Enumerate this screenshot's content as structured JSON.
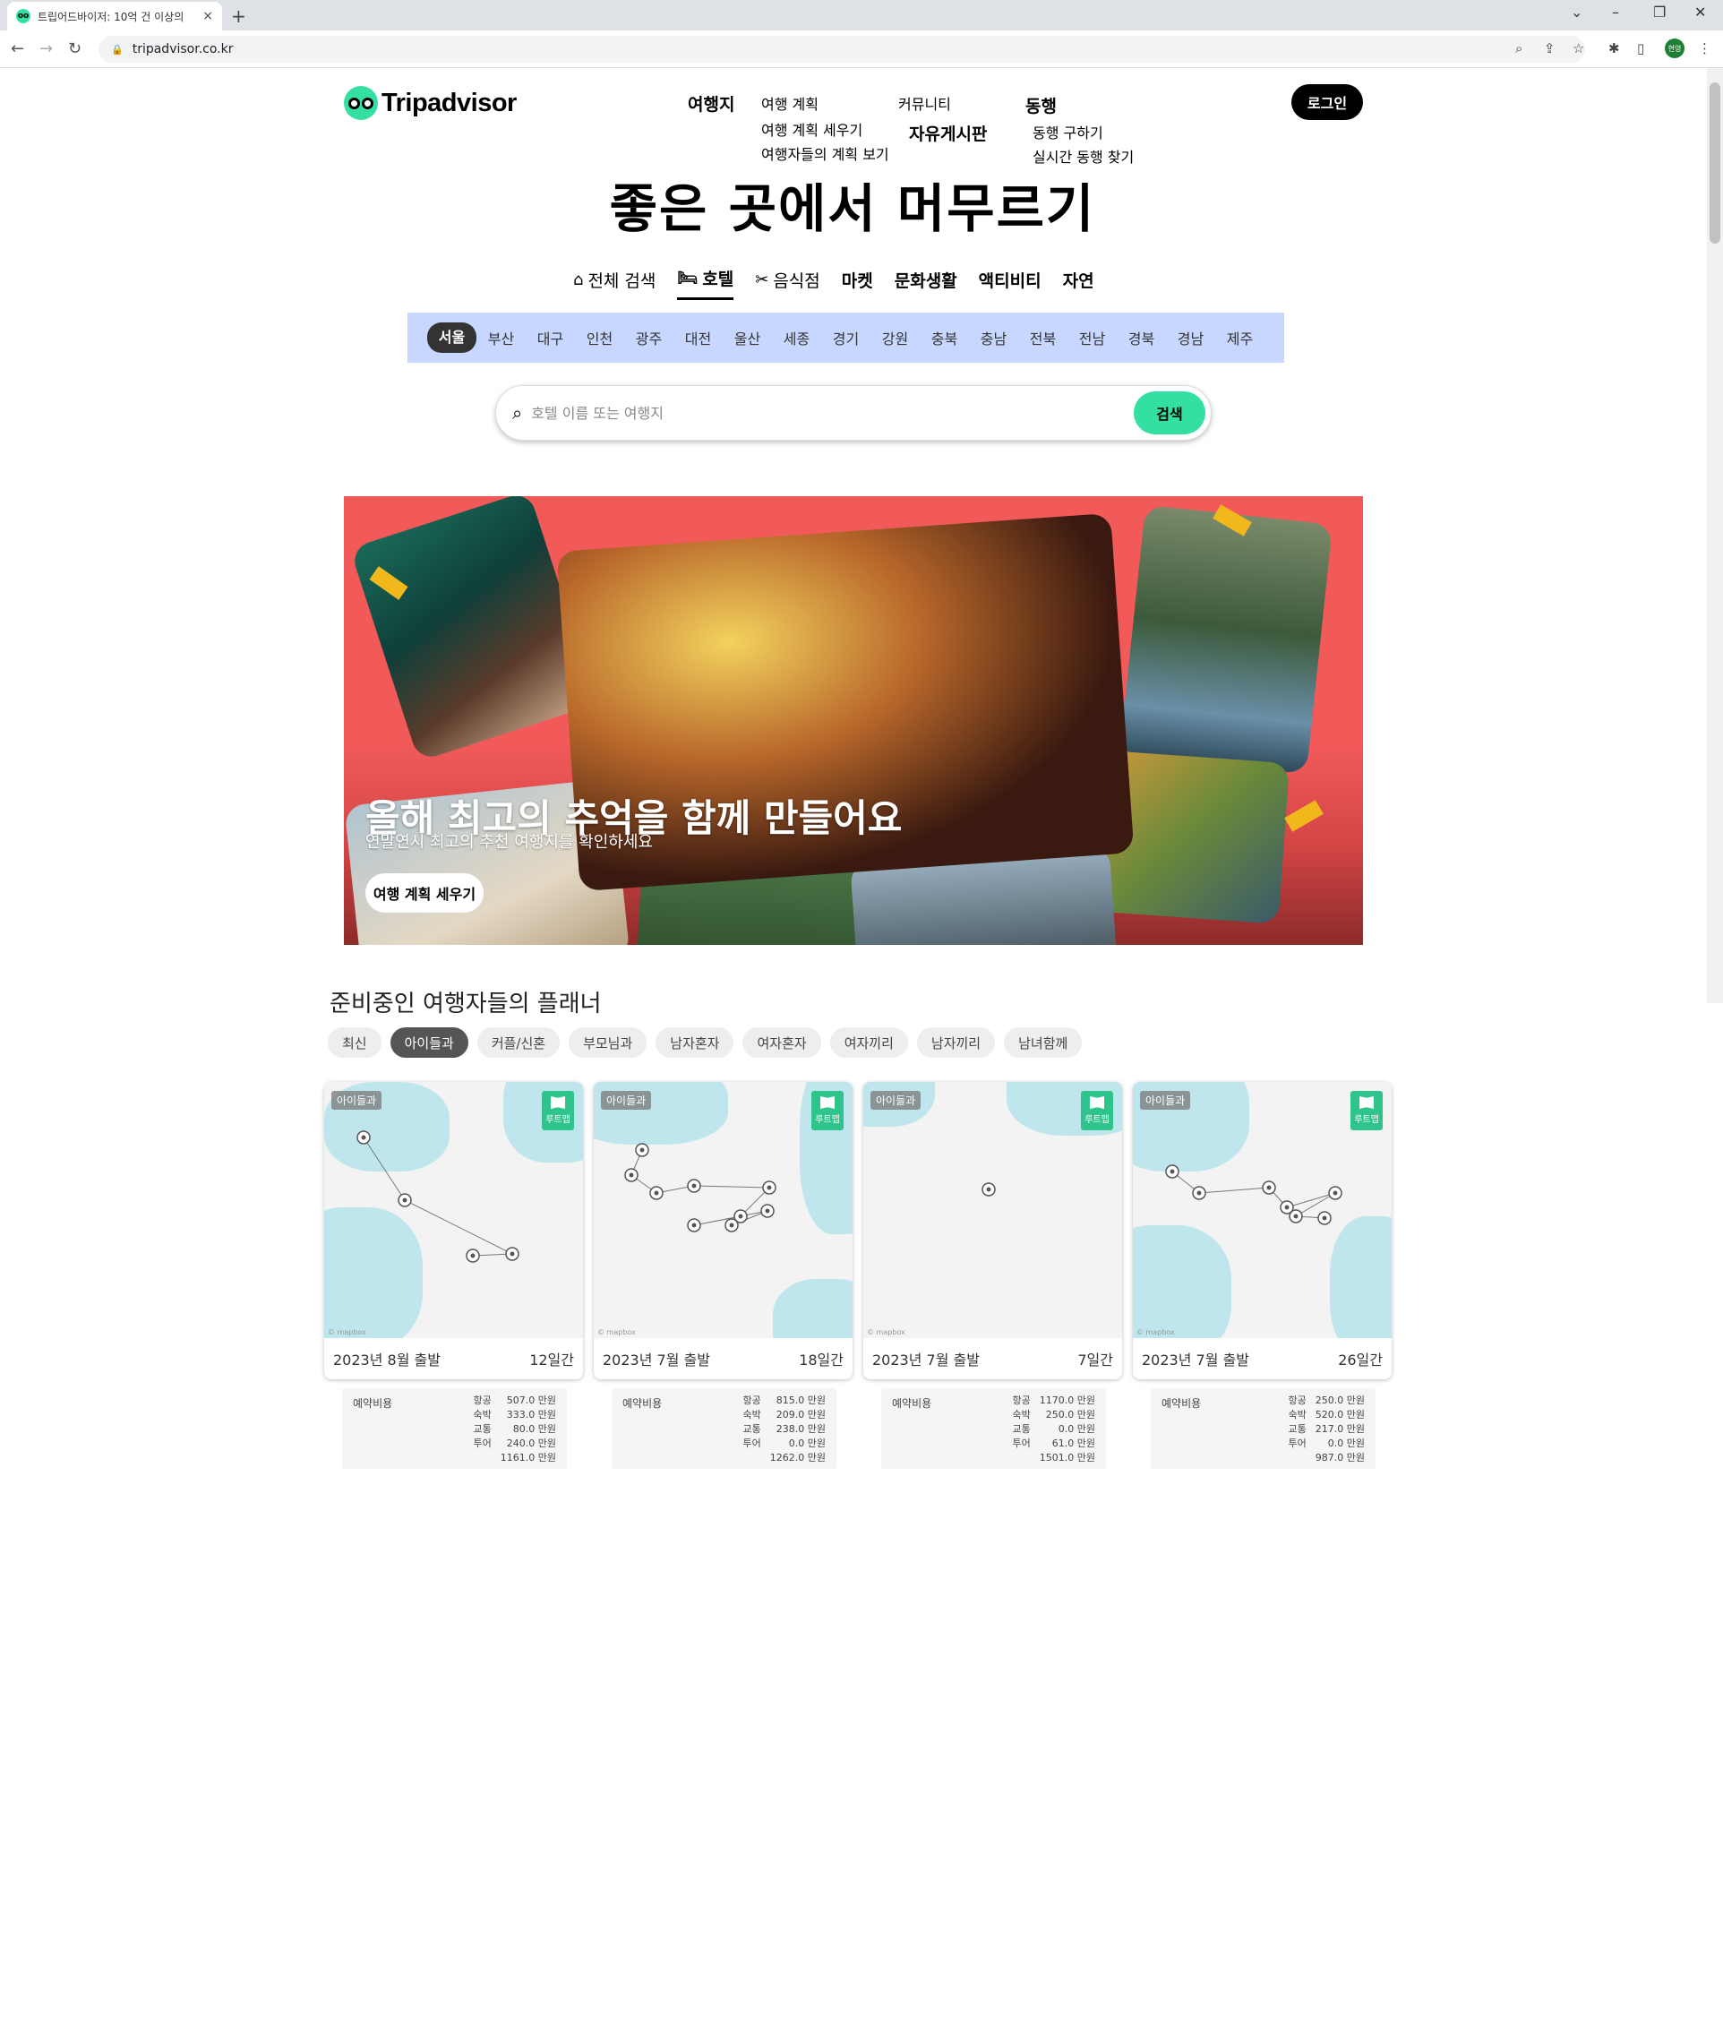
{
  "browser": {
    "tab_title": "트립어드바이저: 10억 건 이상의",
    "tab_favicon": "owl-icon",
    "new_tab": "+",
    "close_tab": "×",
    "url": "tripadvisor.co.kr",
    "profile": "현영"
  },
  "header": {
    "logo_text": "Tripadvisor",
    "nav": {
      "destinations": "여행지",
      "plan": "여행 계획",
      "plan_make": "여행 계획 세우기",
      "plan_view": "여행자들의 계획 보기",
      "community": "커뮤니티",
      "board": "자유게시판",
      "companion": "동행",
      "companion_find": "동행 구하기",
      "companion_live": "실시간 동행 찾기"
    },
    "login": "로그인"
  },
  "hero": {
    "title": "좋은 곳에서 머무르기"
  },
  "categories": [
    {
      "label": "전체 검색",
      "icon": "home-icon"
    },
    {
      "label": "호텔",
      "icon": "bed-icon"
    },
    {
      "label": "음식점",
      "icon": "cutlery-icon"
    },
    {
      "label": "마켓"
    },
    {
      "label": "문화생활"
    },
    {
      "label": "액티비티"
    },
    {
      "label": "자연"
    }
  ],
  "regions": [
    "서울",
    "부산",
    "대구",
    "인천",
    "광주",
    "대전",
    "울산",
    "세종",
    "경기",
    "강원",
    "충북",
    "충남",
    "전북",
    "전남",
    "경북",
    "경남",
    "제주"
  ],
  "search": {
    "placeholder": "호텔 이름 또는 여행지",
    "button": "검색"
  },
  "banner": {
    "title": "올해 최고의 추억을 함께 만들어요",
    "subtitle": "연말연시 최고의 추천 여행지를 확인하세요",
    "button": "여행 계획 세우기"
  },
  "planners": {
    "title": "준비중인 여행자들의 플래너",
    "filters": [
      "최신",
      "아이들과",
      "커플/신혼",
      "부모님과",
      "남자혼자",
      "여자혼자",
      "여자끼리",
      "남자끼리",
      "남녀함께"
    ],
    "active_filter": "아이들과",
    "cards": [
      {
        "tag": "아이들과",
        "badge": "루트맵",
        "start": "2023년 8월 출발",
        "days": "12일간",
        "cost_label": "예약비용",
        "costs": [
          [
            "항공",
            "507.0 만원"
          ],
          [
            "숙박",
            "333.0 만원"
          ],
          [
            "교통",
            "80.0 만원"
          ],
          [
            "투어",
            "240.0 만원"
          ]
        ],
        "total": "1161.0 만원"
      },
      {
        "tag": "아이들과",
        "badge": "루트맵",
        "start": "2023년 7월 출발",
        "days": "18일간",
        "cost_label": "예약비용",
        "costs": [
          [
            "항공",
            "815.0 만원"
          ],
          [
            "숙박",
            "209.0 만원"
          ],
          [
            "교통",
            "238.0 만원"
          ],
          [
            "투어",
            "0.0 만원"
          ]
        ],
        "total": "1262.0 만원"
      },
      {
        "tag": "아이들과",
        "badge": "루트맵",
        "start": "2023년 7월 출발",
        "days": "7일간",
        "cost_label": "예약비용",
        "costs": [
          [
            "항공",
            "1170.0 만원"
          ],
          [
            "숙박",
            "250.0 만원"
          ],
          [
            "교통",
            "0.0 만원"
          ],
          [
            "투어",
            "61.0 만원"
          ]
        ],
        "total": "1501.0 만원"
      },
      {
        "tag": "아이들과",
        "badge": "루트맵",
        "start": "2023년 7월 출발",
        "days": "26일간",
        "cost_label": "예약비용",
        "costs": [
          [
            "항공",
            "250.0 만원"
          ],
          [
            "숙박",
            "520.0 만원"
          ],
          [
            "교통",
            "217.0 만원"
          ],
          [
            "투어",
            "0.0 만원"
          ]
        ],
        "total": "987.0 만원"
      }
    ]
  }
}
